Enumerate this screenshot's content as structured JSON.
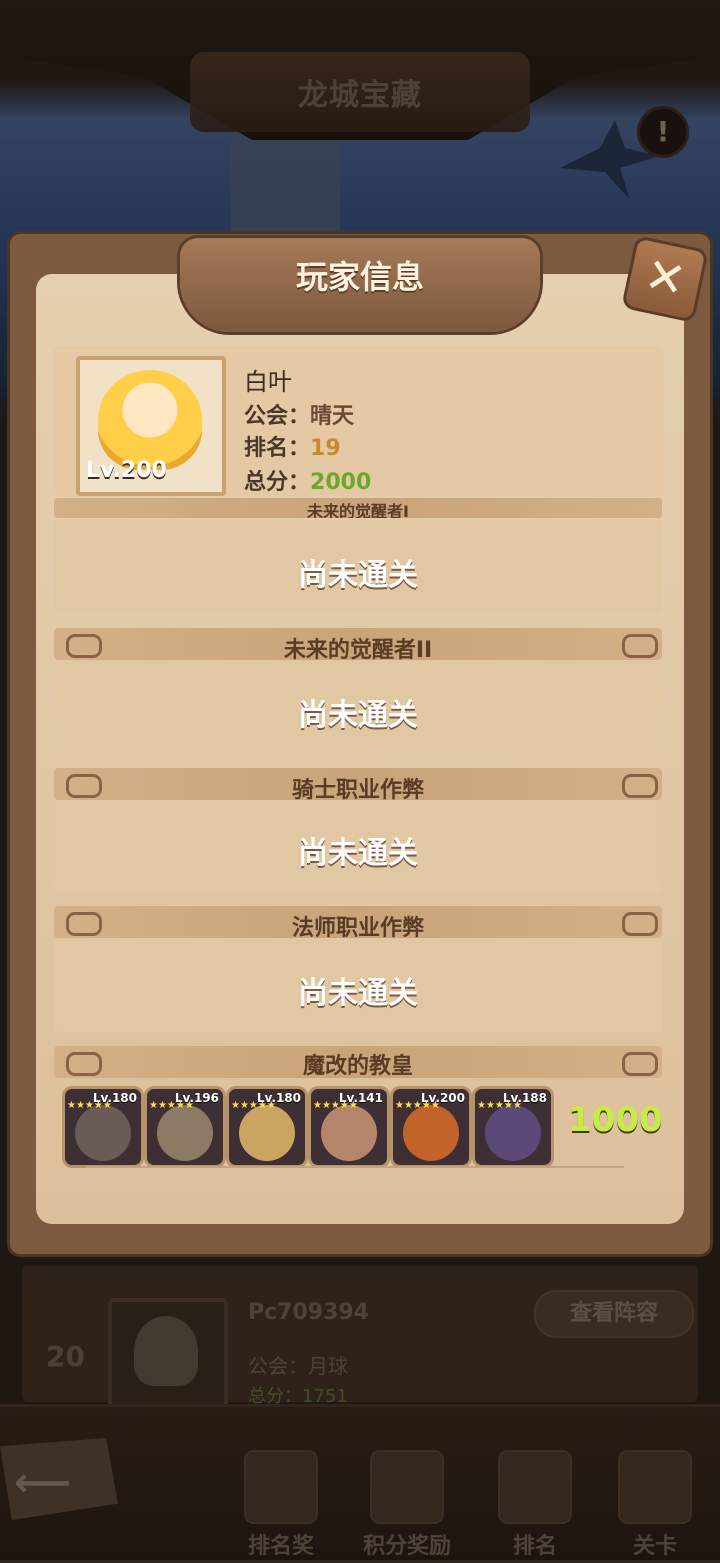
{
  "page": {
    "title": "龙城宝藏"
  },
  "under_list": {
    "rank": "20",
    "name": "Pc709394",
    "guild_label": "公会：",
    "guild_value": "月球",
    "score_label": "总分：",
    "score_value": "1751",
    "view_button": "查看阵容"
  },
  "bottom_nav": {
    "items": [
      {
        "label": "排名奖"
      },
      {
        "label": "积分奖励"
      },
      {
        "label": "排名"
      },
      {
        "label": "关卡"
      }
    ]
  },
  "popup": {
    "title": "玩家信息",
    "player": {
      "level": "Lv.200",
      "name": "白叶",
      "guild_label": "公会：",
      "guild_value": "晴天",
      "rank_label": "排名：",
      "rank_value": "19",
      "score_label": "总分：",
      "score_value": "2000"
    },
    "sections": [
      {
        "title": "未来的觉醒者I",
        "status": "尚未通关"
      },
      {
        "title": "未来的觉醒者II",
        "status": "尚未通关"
      },
      {
        "title": "骑士职业作弊",
        "status": "尚未通关"
      },
      {
        "title": "法师职业作弊",
        "status": "尚未通关"
      }
    ],
    "last_section": {
      "title": "魔改的教皇",
      "team": [
        {
          "level": "Lv.180",
          "color": "#6a5b56"
        },
        {
          "level": "Lv.196",
          "color": "#8b7b64"
        },
        {
          "level": "Lv.180",
          "color": "#caa562"
        },
        {
          "level": "Lv.141",
          "color": "#b4856a"
        },
        {
          "level": "Lv.200",
          "color": "#c2642a"
        },
        {
          "level": "Lv.188",
          "color": "#5b4a79"
        }
      ],
      "score": "1000"
    }
  }
}
